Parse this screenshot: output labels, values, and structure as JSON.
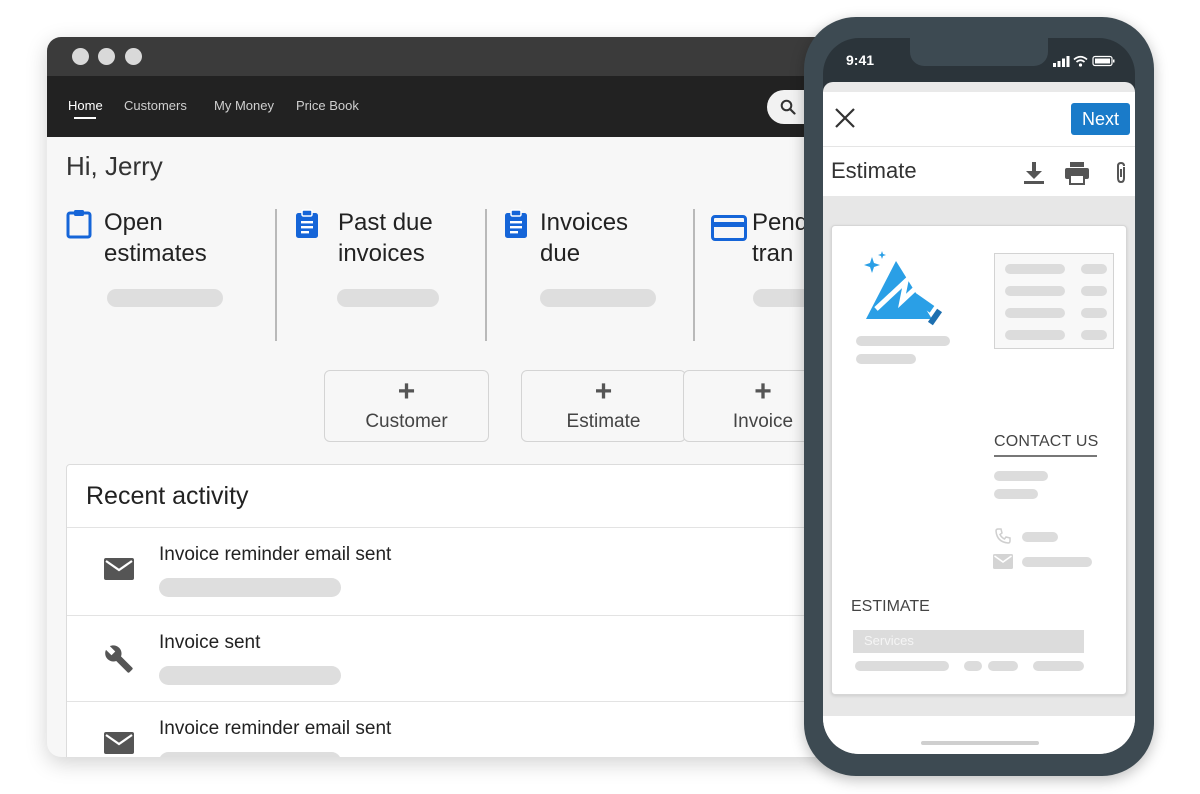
{
  "desktop": {
    "nav": {
      "items": [
        "Home",
        "Customers",
        "My Money",
        "Price Book"
      ],
      "active": "Home"
    },
    "greeting": "Hi, Jerry",
    "stats": [
      {
        "line1": "Open",
        "line2": "estimates",
        "icon": "clipboard-icon"
      },
      {
        "line1": "Past due",
        "line2": "invoices",
        "icon": "clipboard-list-icon"
      },
      {
        "line1": "Invoices",
        "line2": "due",
        "icon": "clipboard-list-icon"
      },
      {
        "line1": "Pend",
        "line2": "tran",
        "icon": "credit-card-icon"
      }
    ],
    "quick_actions": [
      {
        "plus": "+",
        "label": "Customer"
      },
      {
        "plus": "+",
        "label": "Estimate"
      },
      {
        "plus": "+",
        "label": "Invoice"
      }
    ],
    "activity": {
      "title": "Recent activity",
      "items": [
        {
          "text": "Invoice reminder email sent",
          "icon": "mail-icon"
        },
        {
          "text": "Invoice sent",
          "icon": "wrench-icon"
        },
        {
          "text": "Invoice reminder email sent",
          "icon": "mail-icon"
        }
      ]
    },
    "colors": {
      "accent_blue": "#1565d8",
      "navbar": "#222222"
    }
  },
  "phone": {
    "status_time": "9:41",
    "next_label": "Next",
    "title": "Estimate",
    "doc": {
      "contact_label": "CONTACT US",
      "estimate_label": "ESTIMATE",
      "services_label": "Services"
    },
    "colors": {
      "next_button": "#1a7bc9",
      "logo_blue": "#2a9fe6"
    }
  }
}
